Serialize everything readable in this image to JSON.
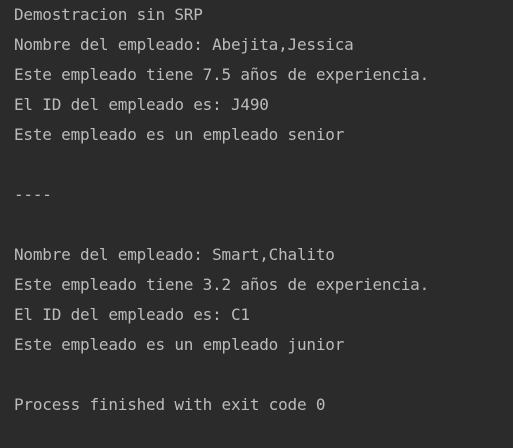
{
  "console": {
    "lines": [
      "Demostracion sin SRP",
      "Nombre del empleado: Abejita,Jessica",
      "Este empleado tiene 7.5 años de experiencia.",
      "El ID del empleado es: J490",
      "Este empleado es un empleado senior",
      "",
      "----",
      "",
      "Nombre del empleado: Smart,Chalito",
      "Este empleado tiene 3.2 años de experiencia.",
      "El ID del empleado es: C1",
      "Este empleado es un empleado junior",
      "",
      "Process finished with exit code 0"
    ]
  }
}
